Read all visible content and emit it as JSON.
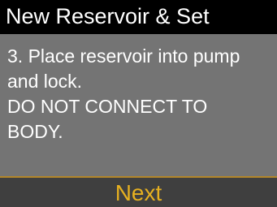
{
  "header": {
    "title": "New Reservoir & Set"
  },
  "instructions": {
    "lines": [
      "3. Place reservoir into pump",
      "and lock.",
      "DO NOT CONNECT TO",
      "BODY."
    ]
  },
  "softkey": {
    "label": "Next"
  },
  "colors": {
    "title_background": "#000000",
    "body_background": "#747474",
    "softkey_background": "#3f3f3f",
    "accent": "#e6b020",
    "divider": "#b3862a",
    "text": "#ffffff"
  }
}
